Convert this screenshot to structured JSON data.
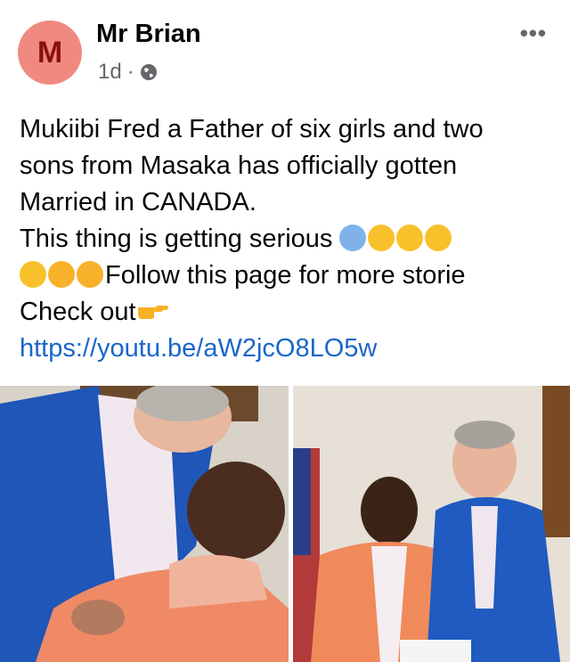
{
  "post": {
    "author": "Mr Brian",
    "avatar_initial": "M",
    "time": "1d",
    "separator": "·",
    "more_icon": "more-horizontal-icon",
    "lines": [
      "Mukiibi Fred a Father of six girls and two",
      "sons from Masaka has officially gotten",
      "Married in CANADA.",
      "This thing is getting serious ",
      "Follow this page for more storie",
      "Check out"
    ],
    "link": "https://youtu.be/aW2jcO8LO5w"
  },
  "colors": {
    "accent_link": "#1b66c9",
    "avatar_bg": "#f08a80",
    "meta": "#65676b"
  }
}
